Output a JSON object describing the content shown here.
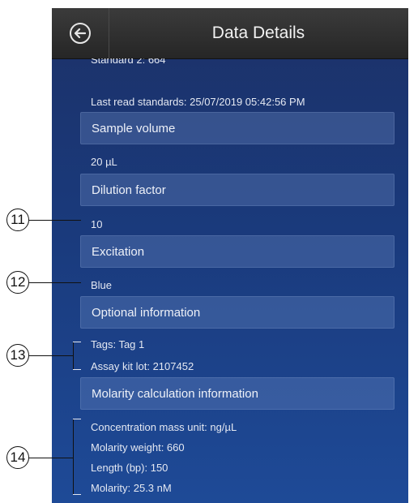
{
  "header": {
    "title": "Data Details",
    "back_icon": "back-arrow-icon"
  },
  "details": {
    "standard2_partial": "Standard 2: 664",
    "last_read": "Last read standards: 25/07/2019 05:42:56 PM",
    "sample_volume_header": "Sample volume",
    "sample_volume_value": "20 µL",
    "dilution_header": "Dilution factor",
    "dilution_value": "10",
    "excitation_header": "Excitation",
    "excitation_value": "Blue",
    "optional_header": "Optional information",
    "tags": "Tags: Tag 1",
    "assay_kit_lot": "Assay kit lot: 2107452",
    "molarity_header": "Molarity calculation information",
    "conc_unit": "Concentration mass unit: ng/µL",
    "molarity_weight": "Molarity weight: 660",
    "length": "Length (bp): 150",
    "molarity": "Molarity: 25.3 nM"
  },
  "callouts": {
    "c11": "11",
    "c12": "12",
    "c13": "13",
    "c14": "14"
  },
  "colors": {
    "header_bg": "#2a2a2a",
    "content_bg": "#1a3a7c",
    "section_bg": "#4a64a0"
  }
}
